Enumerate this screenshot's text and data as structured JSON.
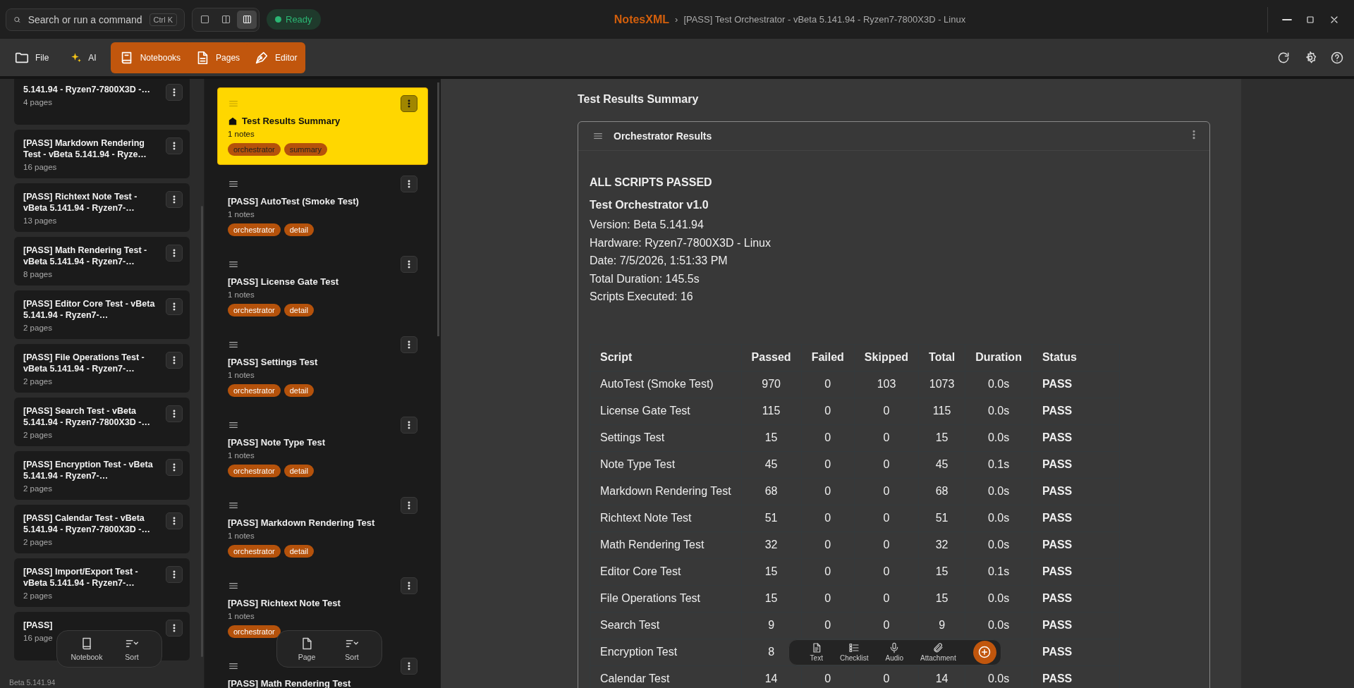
{
  "search": {
    "placeholder": "Search or run a command",
    "shortcut": "Ctrl K"
  },
  "layout_buttons": [
    {
      "kind": "single",
      "selected": false
    },
    {
      "kind": "split",
      "selected": false
    },
    {
      "kind": "triple",
      "selected": true
    }
  ],
  "status": {
    "label": "Ready"
  },
  "title": {
    "app": "NotesXML",
    "separator": "›",
    "document": "[PASS] Test Orchestrator - vBeta 5.141.94 - Ryzen7-7800X3D - Linux"
  },
  "toolbar": [
    {
      "kind": "file",
      "label": "File",
      "selected": false
    },
    {
      "kind": "ai",
      "label": "AI",
      "selected": false
    },
    {
      "kind": "notebooks",
      "label": "Notebooks",
      "selected": true
    },
    {
      "kind": "pages",
      "label": "Pages",
      "selected": true
    },
    {
      "kind": "editor",
      "label": "Editor",
      "selected": true
    }
  ],
  "notebooks": [
    {
      "title": "5.141.94 - Ryzen7-7800X3D -…",
      "pages": "4 pages"
    },
    {
      "title": "[PASS] Markdown Rendering Test - vBeta 5.141.94 - Ryze…",
      "pages": "16 pages"
    },
    {
      "title": "[PASS] Richtext Note Test - vBeta 5.141.94 - Ryzen7-…",
      "pages": "13 pages"
    },
    {
      "title": "[PASS] Math Rendering Test - vBeta 5.141.94 - Ryzen7-…",
      "pages": "8 pages"
    },
    {
      "title": "[PASS] Editor Core Test - vBeta 5.141.94 - Ryzen7-…",
      "pages": "2 pages"
    },
    {
      "title": "[PASS] File Operations Test - vBeta 5.141.94 - Ryzen7-…",
      "pages": "2 pages"
    },
    {
      "title": "[PASS] Search Test - vBeta 5.141.94 - Ryzen7-7800X3D -…",
      "pages": "2 pages"
    },
    {
      "title": "[PASS] Encryption Test - vBeta 5.141.94 - Ryzen7-…",
      "pages": "2 pages"
    },
    {
      "title": "[PASS] Calendar Test - vBeta 5.141.94 - Ryzen7-7800X3D -…",
      "pages": "2 pages"
    },
    {
      "title": "[PASS] Import/Export Test - vBeta 5.141.94 - Ryzen7-…",
      "pages": "2 pages"
    },
    {
      "title": "[PASS]",
      "pages": "16 page"
    }
  ],
  "notebook_bar": [
    {
      "kind": "notebook",
      "label": "Notebook"
    },
    {
      "kind": "sort",
      "label": "Sort"
    }
  ],
  "version": "Beta 5.141.94",
  "pages": [
    {
      "kind": "home",
      "title": "Test Results Summary",
      "notes": "1 notes",
      "tags": [
        "orchestrator",
        "summary"
      ],
      "selected": true
    },
    {
      "kind": "plain",
      "title": "[PASS] AutoTest (Smoke Test)",
      "notes": "1 notes",
      "tags": [
        "orchestrator",
        "detail"
      ],
      "selected": false
    },
    {
      "kind": "plain",
      "title": "[PASS] License Gate Test",
      "notes": "1 notes",
      "tags": [
        "orchestrator",
        "detail"
      ],
      "selected": false
    },
    {
      "kind": "plain",
      "title": "[PASS] Settings Test",
      "notes": "1 notes",
      "tags": [
        "orchestrator",
        "detail"
      ],
      "selected": false
    },
    {
      "kind": "plain",
      "title": "[PASS] Note Type Test",
      "notes": "1 notes",
      "tags": [
        "orchestrator",
        "detail"
      ],
      "selected": false
    },
    {
      "kind": "plain",
      "title": "[PASS] Markdown Rendering Test",
      "notes": "1 notes",
      "tags": [
        "orchestrator",
        "detail"
      ],
      "selected": false
    },
    {
      "kind": "plain",
      "title": "[PASS] Richtext Note Test",
      "notes": "1 notes",
      "tags": [
        "orchestrator"
      ],
      "selected": false
    },
    {
      "kind": "plain",
      "title": "[PASS] Math Rendering Test",
      "selected": false
    }
  ],
  "page_bar": [
    {
      "kind": "page",
      "label": "Page"
    },
    {
      "kind": "sort",
      "label": "Sort"
    }
  ],
  "note": {
    "page_title": "Test Results Summary",
    "card_title": "Orchestrator Results",
    "heading": "ALL SCRIPTS PASSED",
    "subheading": "Test Orchestrator v1.0",
    "lines": [
      "Version: Beta 5.141.94",
      "Hardware: Ryzen7-7800X3D - Linux",
      "Date: 7/5/2026, 1:51:33 PM",
      "Total Duration: 145.5s",
      "Scripts Executed: 16"
    ],
    "table": {
      "columns": [
        "Script",
        "Passed",
        "Failed",
        "Skipped",
        "Total",
        "Duration",
        "Status"
      ],
      "rows": [
        [
          "AutoTest (Smoke Test)",
          "970",
          "0",
          "103",
          "1073",
          "0.0s",
          "PASS"
        ],
        [
          "License Gate Test",
          "115",
          "0",
          "0",
          "115",
          "0.0s",
          "PASS"
        ],
        [
          "Settings Test",
          "15",
          "0",
          "0",
          "15",
          "0.0s",
          "PASS"
        ],
        [
          "Note Type Test",
          "45",
          "0",
          "0",
          "45",
          "0.1s",
          "PASS"
        ],
        [
          "Markdown Rendering Test",
          "68",
          "0",
          "0",
          "68",
          "0.0s",
          "PASS"
        ],
        [
          "Richtext Note Test",
          "51",
          "0",
          "0",
          "51",
          "0.0s",
          "PASS"
        ],
        [
          "Math Rendering Test",
          "32",
          "0",
          "0",
          "32",
          "0.0s",
          "PASS"
        ],
        [
          "Editor Core Test",
          "15",
          "0",
          "0",
          "15",
          "0.1s",
          "PASS"
        ],
        [
          "File Operations Test",
          "15",
          "0",
          "0",
          "15",
          "0.0s",
          "PASS"
        ],
        [
          "Search Test",
          "9",
          "0",
          "0",
          "9",
          "0.0s",
          "PASS"
        ],
        [
          "Encryption Test",
          "8",
          null,
          null,
          null,
          null,
          "PASS"
        ],
        [
          "Calendar Test",
          "14",
          "0",
          "0",
          "14",
          "0.0s",
          "PASS"
        ]
      ]
    }
  },
  "insert_bar": [
    {
      "kind": "text",
      "label": "Text"
    },
    {
      "kind": "checklist",
      "label": "Checklist"
    },
    {
      "kind": "audio",
      "label": "Audio"
    },
    {
      "kind": "attachment",
      "label": "Attachment"
    }
  ]
}
